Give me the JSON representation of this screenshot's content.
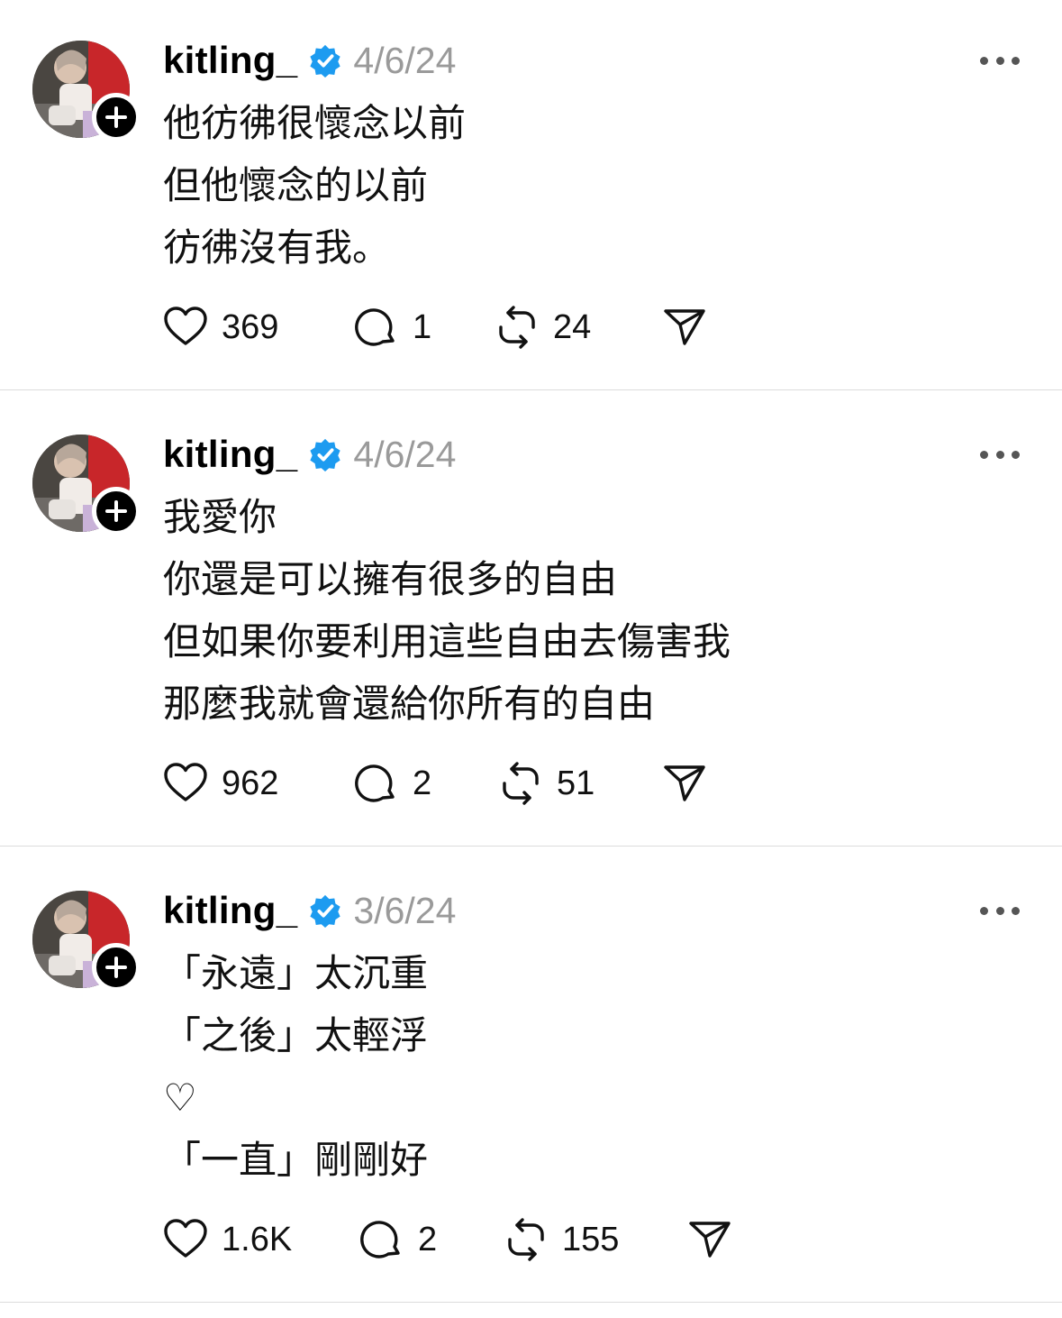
{
  "posts": [
    {
      "username": "kitling_",
      "date": "4/6/24",
      "lines": [
        "他彷彿很懷念以前",
        "但他懷念的以前",
        "彷彿沒有我。"
      ],
      "likes": "369",
      "replies": "1",
      "reposts": "24"
    },
    {
      "username": "kitling_",
      "date": "4/6/24",
      "lines": [
        "我愛你",
        "你還是可以擁有很多的自由",
        "但如果你要利用這些自由去傷害我",
        "那麼我就會還給你所有的自由"
      ],
      "likes": "962",
      "replies": "2",
      "reposts": "51"
    },
    {
      "username": "kitling_",
      "date": "3/6/24",
      "lines": [
        "「永遠」太沉重",
        "「之後」太輕浮",
        "♡",
        "「一直」剛剛好"
      ],
      "likes": "1.6K",
      "replies": "2",
      "reposts": "155"
    }
  ],
  "colors": {
    "verified": "#1d9bf0",
    "date": "#9a9a9a",
    "divider": "#dcdcdc"
  },
  "icons": [
    "heart-icon",
    "comment-icon",
    "repost-icon",
    "share-icon",
    "verified-badge-icon",
    "more-icon",
    "plus-icon"
  ]
}
